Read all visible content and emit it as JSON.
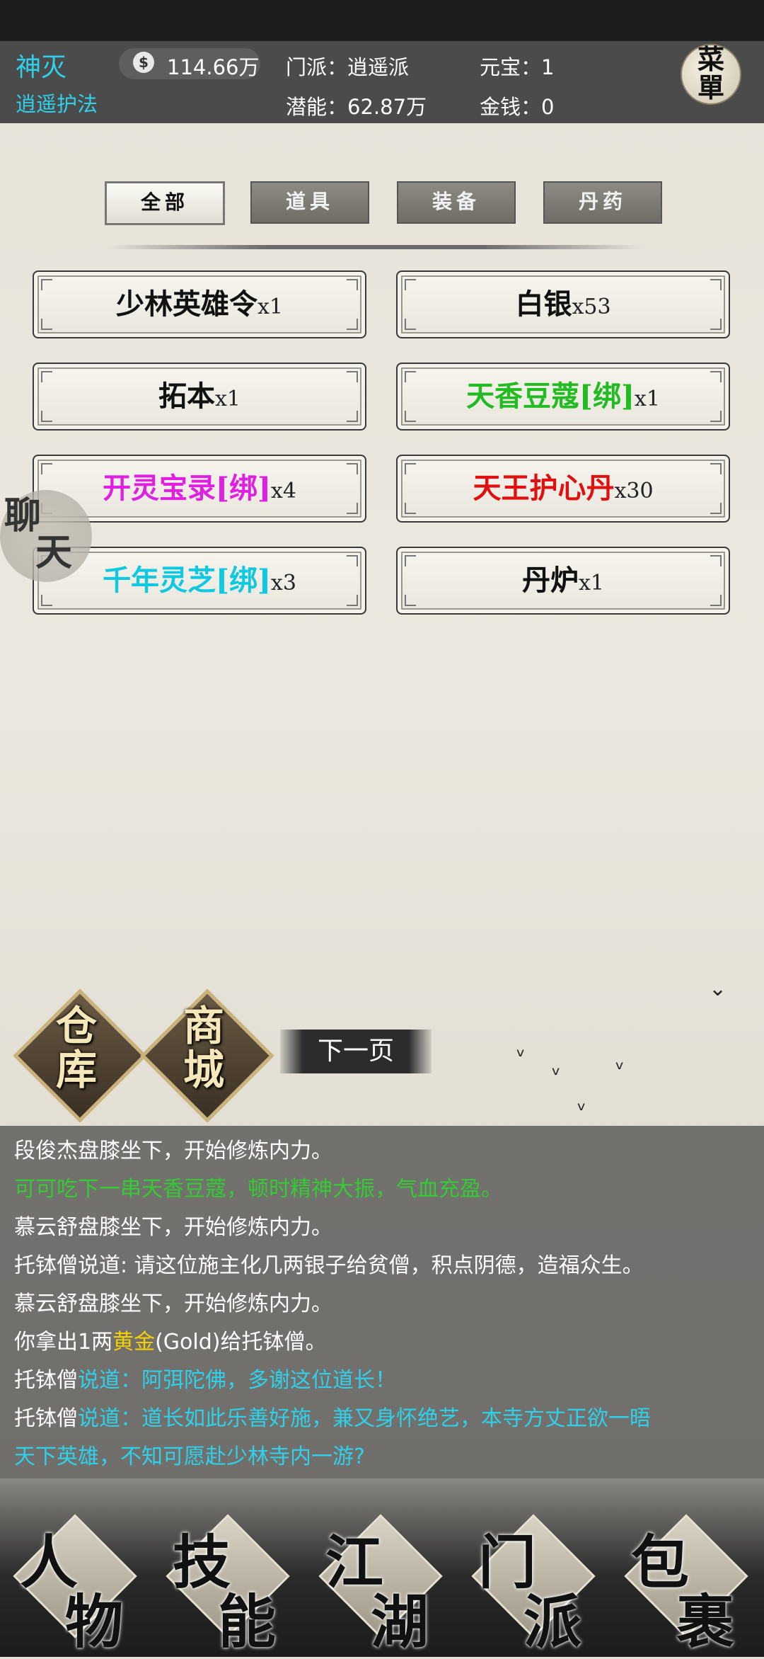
{
  "header": {
    "player_name": "神灭",
    "player_title": "逍遥护法",
    "coin_icon": "yin-yang-icon",
    "coin_symbol": "$",
    "coins": "114.66万",
    "sect": "门派：逍遥派",
    "potential": "潜能：62.87万",
    "yuanbao": "元宝：1",
    "money": "金钱：0",
    "menu_char_1": "菜",
    "menu_char_2": "單"
  },
  "tabs": [
    {
      "label": "全部",
      "active": true
    },
    {
      "label": "道具",
      "active": false
    },
    {
      "label": "装备",
      "active": false
    },
    {
      "label": "丹药",
      "active": false
    }
  ],
  "items": [
    {
      "name": "少林英雄令",
      "qty": "x1",
      "color": "#111111"
    },
    {
      "name": "白银",
      "qty": "x53",
      "color": "#111111"
    },
    {
      "name": "拓本",
      "qty": "x1",
      "color": "#111111"
    },
    {
      "name": "天香豆蔻[绑]",
      "qty": "x1",
      "color": "#22bb22"
    },
    {
      "name": "开灵宝录[绑]",
      "qty": "x4",
      "color": "#e020e0"
    },
    {
      "name": "天王护心丹",
      "qty": "x30",
      "color": "#e01010"
    },
    {
      "name": "千年灵芝[绑]",
      "qty": "x3",
      "color": "#10c8e0"
    },
    {
      "name": "丹炉",
      "qty": "x1",
      "color": "#111111"
    }
  ],
  "side_chat": {
    "char_1": "聊",
    "char_2": "天"
  },
  "actions": {
    "warehouse_1": "仓",
    "warehouse_2": "库",
    "shop_1": "商",
    "shop_2": "城",
    "next_page": "下一页"
  },
  "log": {
    "l1": "段俊杰盘膝坐下，开始修炼内力。",
    "l2": "可可吃下一串天香豆蔻，顿时精神大振，气血充盈。",
    "l3": "慕云舒盘膝坐下，开始修炼内力。",
    "l4": "托钵僧说道: 请这位施主化几两银子给贫僧，积点阴德，造福众生。",
    "l5": "慕云舒盘膝坐下，开始修炼内力。",
    "l6a": "你拿出1两",
    "l6b": "黄金",
    "l6c": "(Gold)给托钵僧。",
    "l7a": "托钵僧",
    "l7b": "说道：阿弭陀佛，多谢这位道长！",
    "l8a": "托钵僧",
    "l8b": "说道：道长如此乐善好施，兼又身怀绝艺，本寺方丈正欲一晤",
    "l9": "天下英雄，不知可愿赴少林寺内一游?"
  },
  "nav": [
    {
      "c1": "人",
      "c2": "物"
    },
    {
      "c1": "技",
      "c2": "能"
    },
    {
      "c1": "江",
      "c2": "湖"
    },
    {
      "c1": "门",
      "c2": "派"
    },
    {
      "c1": "包",
      "c2": "裹"
    }
  ]
}
